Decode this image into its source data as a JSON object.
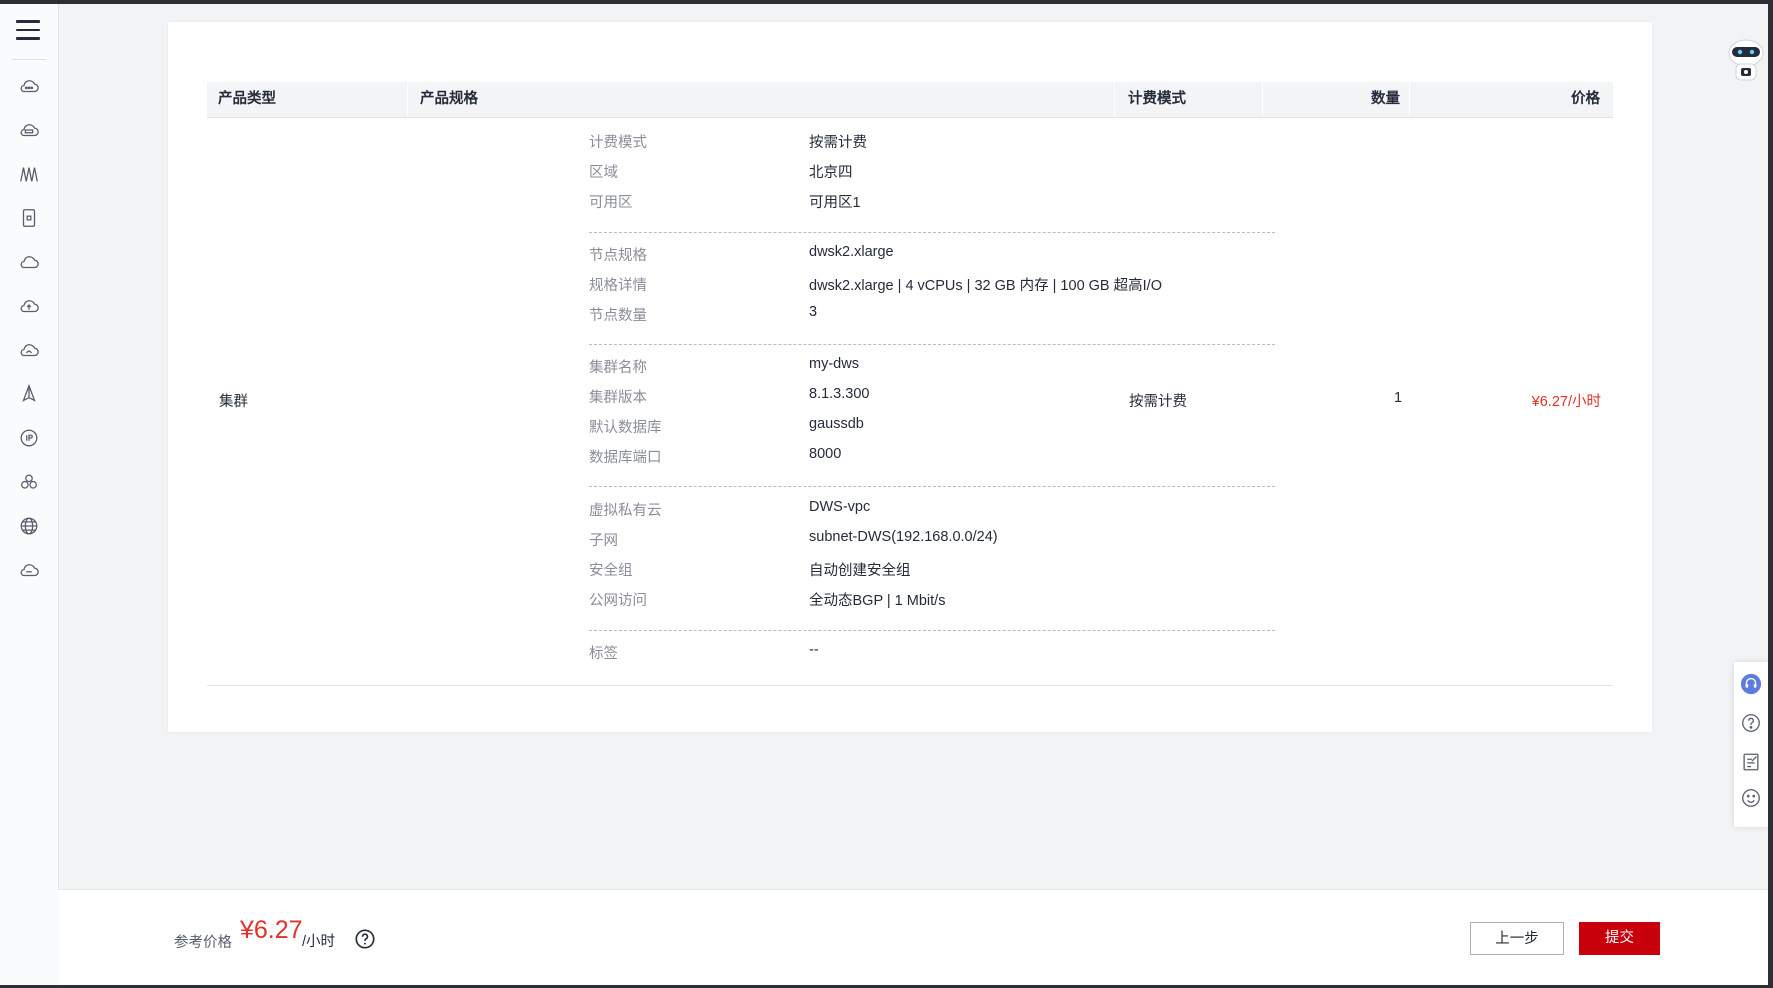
{
  "table": {
    "headers": {
      "product_type": "产品类型",
      "product_spec": "产品规格",
      "billing_mode": "计费模式",
      "quantity": "数量",
      "price": "价格"
    },
    "row": {
      "product_type": "集群",
      "billing_mode": "按需计费",
      "quantity": "1",
      "price": "¥6.27/小时"
    },
    "specs": [
      {
        "label": "计费模式",
        "value": "按需计费"
      },
      {
        "label": "区域",
        "value": "北京四"
      },
      {
        "label": "可用区",
        "value": "可用区1"
      },
      {
        "label": "节点规格",
        "value": "dwsk2.xlarge"
      },
      {
        "label": "规格详情",
        "value": "dwsk2.xlarge | 4 vCPUs | 32 GB 内存 | 100 GB 超高I/O"
      },
      {
        "label": "节点数量",
        "value": "3"
      },
      {
        "label": "集群名称",
        "value": "my-dws"
      },
      {
        "label": "集群版本",
        "value": "8.1.3.300"
      },
      {
        "label": "默认数据库",
        "value": "gaussdb"
      },
      {
        "label": "数据库端口",
        "value": "8000"
      },
      {
        "label": "虚拟私有云",
        "value": "DWS-vpc"
      },
      {
        "label": "子网",
        "value": "subnet-DWS(192.168.0.0/24)"
      },
      {
        "label": "安全组",
        "value": "自动创建安全组"
      },
      {
        "label": "公网访问",
        "value": "全动态BGP | 1 Mbit/s"
      },
      {
        "label": "标签",
        "value": "--"
      }
    ]
  },
  "footer": {
    "reference_label": "参考价格",
    "reference_price": "¥6.27",
    "reference_unit": "/小时",
    "prev_button": "上一步",
    "submit_button": "提交"
  },
  "sidebar": {
    "icons": [
      "cloud-dots-icon",
      "cloud-server-icon",
      "bars-chart-icon",
      "storage-device-icon",
      "cloud-icon",
      "cloud-upload-icon",
      "cloud-sync-icon",
      "navigation-icon",
      "ip-icon",
      "cluster-icon",
      "globe-icon",
      "cloud-gateway-icon"
    ]
  },
  "colors": {
    "accent_red": "#c7000b",
    "price_red": "#e0322a",
    "label_gray": "#8a8e99"
  }
}
